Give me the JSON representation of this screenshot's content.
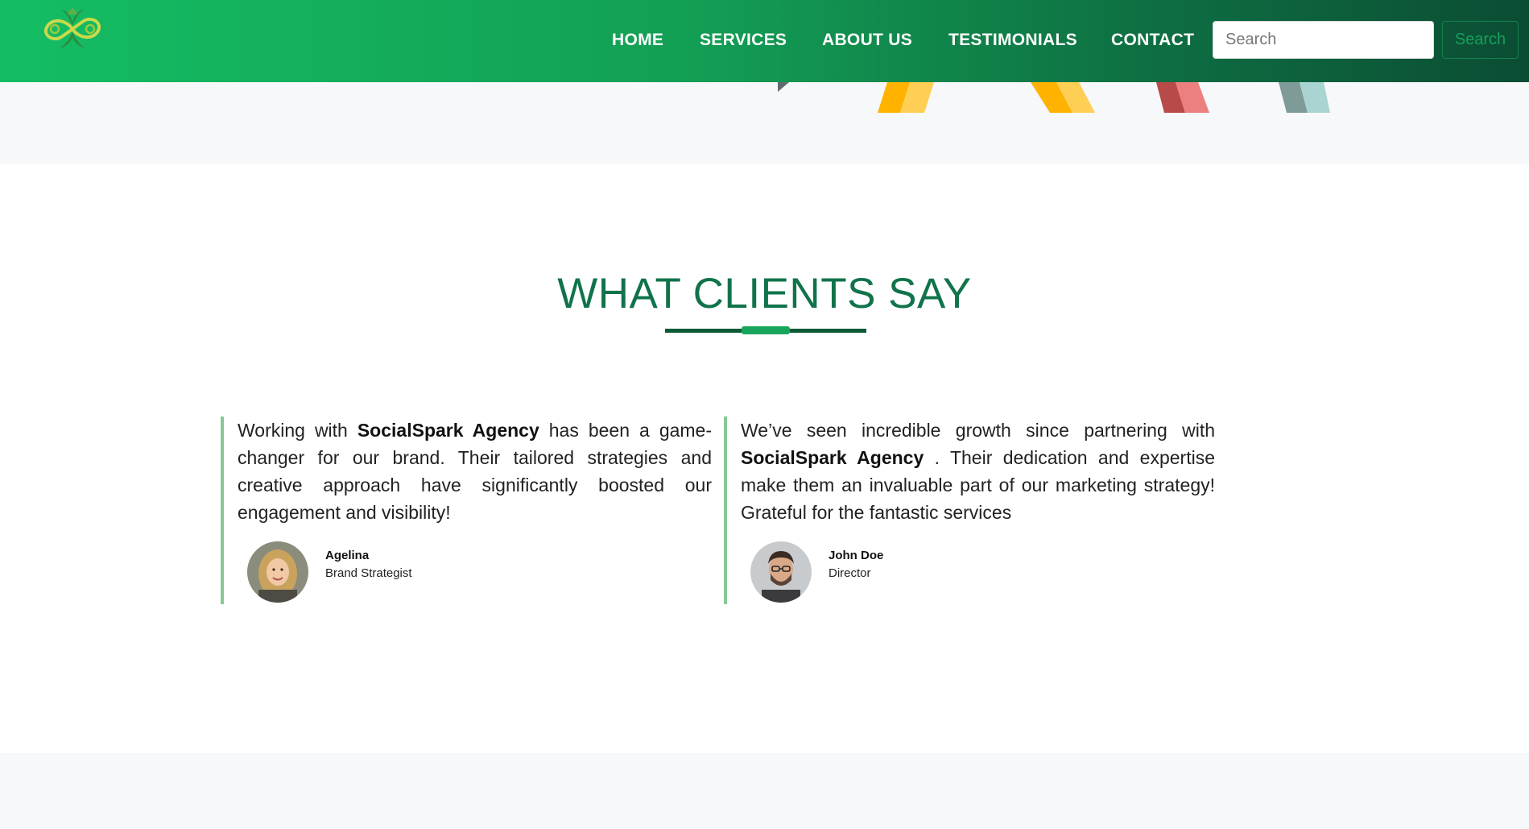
{
  "header": {
    "logo_alt": "infinity-leaf-logo",
    "nav": [
      "HOME",
      "SERVICES",
      "ABOUT US",
      "TESTIMONIALS",
      "CONTACT"
    ],
    "search": {
      "placeholder": "Search",
      "button_label": "Search"
    }
  },
  "testimonials": {
    "title": "WHAT CLIENTS SAY",
    "items": [
      {
        "before": "Working with ",
        "brand": "SocialSpark Agency",
        "after": " has been a game-changer for our brand. Their tailored strategies and creative approach have significantly boosted our engagement and visibility!",
        "name": "Agelina",
        "role": "Brand Strategist"
      },
      {
        "before": "We’ve seen incredible growth since partnering with ",
        "brand": "SocialSpark Agency",
        "after": " . Their dedication and expertise make them an invaluable part of our marketing strategy! Grateful for the fantastic services",
        "name": "John Doe",
        "role": "Director"
      }
    ]
  },
  "colors": {
    "header_start": "#14bd63",
    "header_end": "#0b4d34",
    "title": "#10734a",
    "accent": "#19a65c",
    "card_border": "#86c996"
  }
}
